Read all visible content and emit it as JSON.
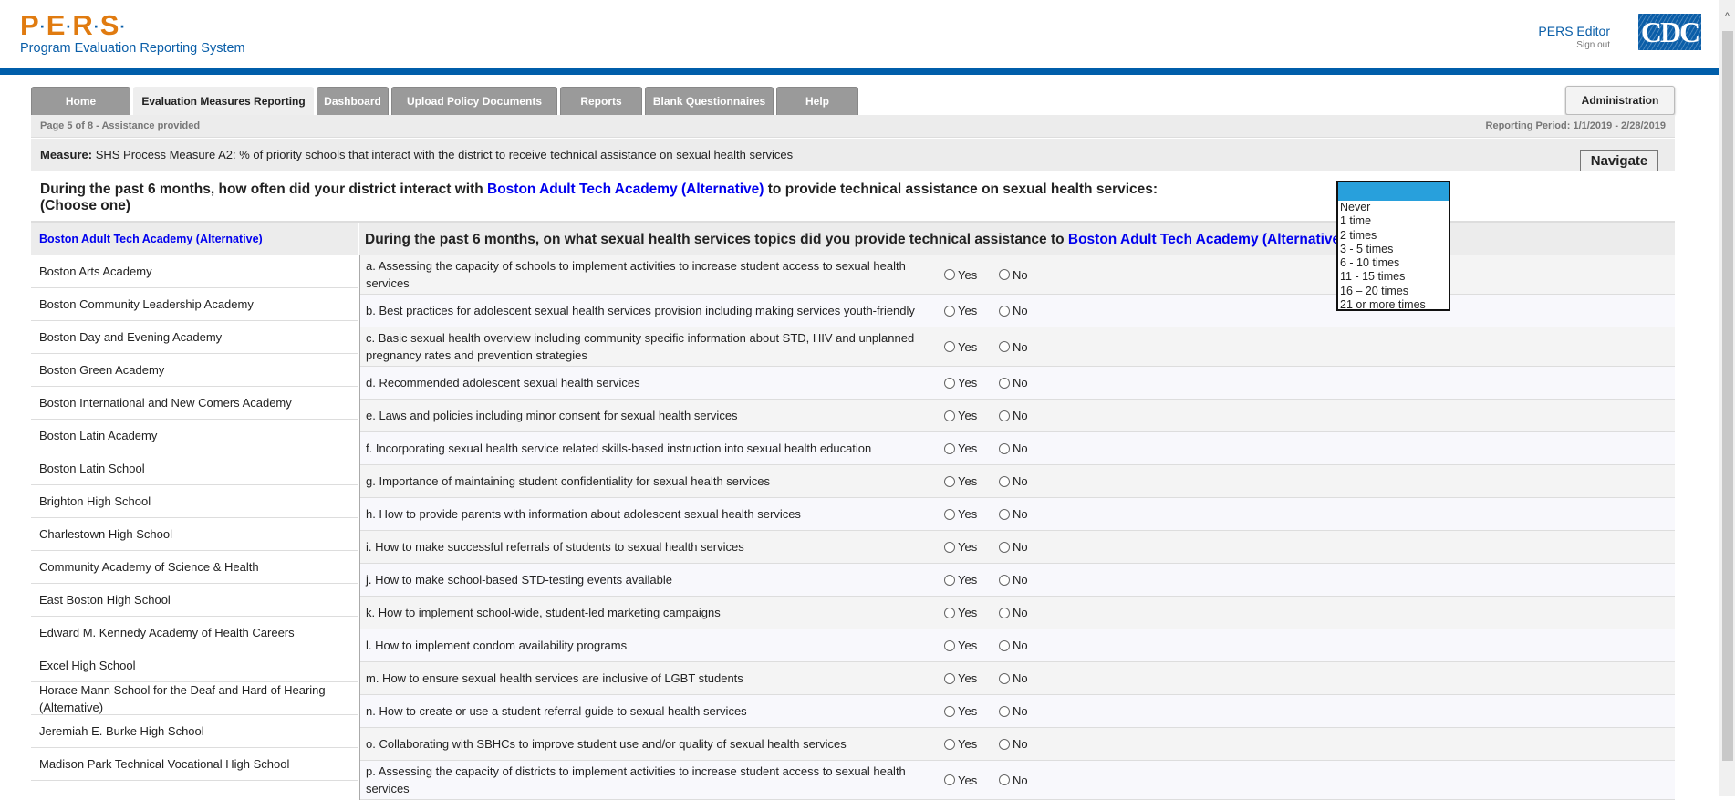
{
  "header": {
    "logo": "P·E·R·S·",
    "subtitle": "Program Evaluation Reporting System",
    "user": "PERS Editor",
    "signout": "Sign out",
    "cdc_logo": "CDC"
  },
  "tabs": [
    {
      "label": "Home"
    },
    {
      "label": "Evaluation Measures Reporting",
      "active": true
    },
    {
      "label": "Dashboard"
    },
    {
      "label": "Upload Policy Documents"
    },
    {
      "label": "Reports"
    },
    {
      "label": "Blank Questionnaires"
    },
    {
      "label": "Help"
    }
  ],
  "admin_label": "Administration",
  "page_info": "Page 5 of 8 - Assistance provided",
  "reporting_period": "Reporting Period: 1/1/2019 - 2/28/2019",
  "measure": {
    "label": "Measure:",
    "text": " SHS Process Measure A2: % of priority schools that interact with the district to receive technical assistance on sexual health services"
  },
  "navigate_label": "Navigate",
  "question": {
    "pre": "During the past 6 months, how often did your district interact with ",
    "school": "Boston Adult Tech Academy (Alternative)",
    "post": " to provide technical assistance on sexual health services:",
    "choose": "(Choose one)"
  },
  "dropdown": {
    "selected": "",
    "options": [
      "Never",
      "1 time",
      "2 times",
      "3 - 5 times",
      "6 - 10 times",
      "11 - 15 times",
      "16 – 20 times",
      "21 or more times"
    ]
  },
  "current_school": "Boston Adult Tech Academy (Alternative)",
  "topics_question": {
    "pre": "During the past 6 months, on what sexual health services topics did you provide technical assistance to ",
    "school": "Boston Adult Tech Academy (Alternative)",
    "post": "?"
  },
  "schools": [
    "Boston Arts Academy",
    "Boston Community Leadership Academy",
    "Boston Day and Evening Academy",
    "Boston Green Academy",
    "Boston International and New Comers Academy",
    "Boston Latin Academy",
    "Boston Latin School",
    "Brighton High School",
    "Charlestown High School",
    "Community Academy of Science & Health",
    "East Boston High School",
    "Edward M. Kennedy Academy of Health Careers",
    "Excel High School",
    "Horace Mann School for the Deaf and Hard of Hearing (Alternative)",
    "Jeremiah E. Burke High School",
    "Madison Park Technical Vocational High School"
  ],
  "yes_label": "Yes",
  "no_label": "No",
  "topics": [
    "a. Assessing the capacity of schools to implement activities to increase student access to sexual health services",
    "b. Best practices for adolescent sexual health services provision including making services youth-friendly",
    "c. Basic sexual health overview including community specific information about STD, HIV and unplanned pregnancy rates and prevention strategies",
    "d. Recommended adolescent sexual health services",
    "e. Laws and policies including minor consent for sexual health services",
    "f. Incorporating sexual health service related skills-based instruction into sexual health education",
    "g. Importance of maintaining student confidentiality for sexual health services",
    "h. How to provide parents with information about adolescent sexual health services",
    "i. How to make successful referrals of students to sexual health services",
    "j. How to make school-based STD-testing events available",
    "k. How to implement school-wide, student-led marketing campaigns",
    "l. How to implement condom availability programs",
    "m. How to ensure sexual health services are inclusive of LGBT students",
    "n. How to create or use a student referral guide to sexual health services",
    "o. Collaborating with SBHCs to improve student use and/or quality of sexual health services",
    "p. Assessing the capacity of districts to implement activities to increase student access to sexual health services"
  ]
}
